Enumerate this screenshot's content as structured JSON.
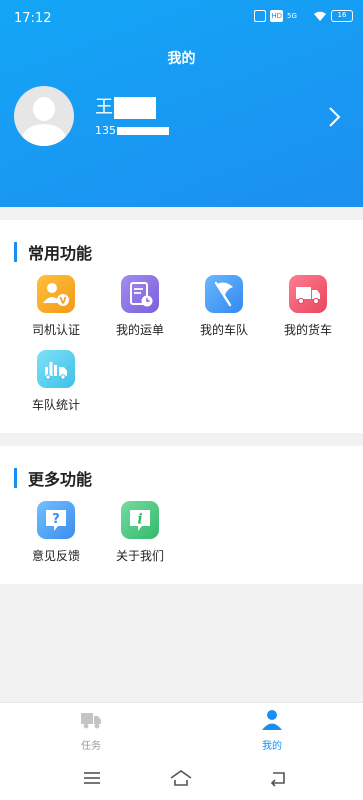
{
  "status_bar": {
    "time": "17:12",
    "hd": "HD",
    "network": "5G",
    "battery": "16"
  },
  "header": {
    "title": "我的",
    "user_name": "王",
    "user_phone": "135"
  },
  "sections": {
    "common": {
      "title": "常用功能",
      "items": [
        {
          "label": "司机认证",
          "icon": "driver-certify-icon",
          "color": "#f5a623"
        },
        {
          "label": "我的运单",
          "icon": "waybill-icon",
          "color": "#8b6fe6"
        },
        {
          "label": "我的车队",
          "icon": "fleet-flag-icon",
          "color": "#4a9ff5"
        },
        {
          "label": "我的货车",
          "icon": "truck-icon",
          "color": "#f0566e"
        },
        {
          "label": "车队统计",
          "icon": "fleet-stats-icon",
          "color": "#52cbee"
        }
      ]
    },
    "more": {
      "title": "更多功能",
      "items": [
        {
          "label": "意见反馈",
          "icon": "feedback-question-icon",
          "color": "#4a9ff5"
        },
        {
          "label": "关于我们",
          "icon": "about-info-icon",
          "color": "#45c27a"
        }
      ]
    }
  },
  "tabbar": {
    "task_label": "任务",
    "mine_label": "我的",
    "active": "我的",
    "active_color": "#1a8ef3"
  }
}
